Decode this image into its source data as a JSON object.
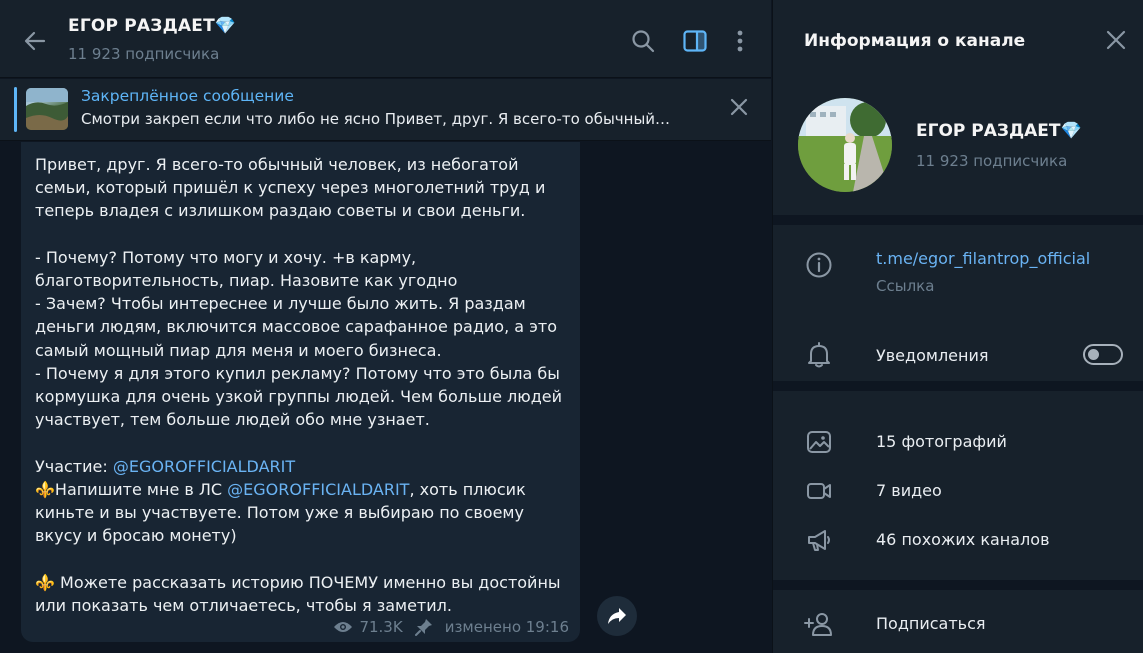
{
  "header": {
    "title": "ЕГОР РАЗДАЕТ💎",
    "subscribers": "11 923 подписчика"
  },
  "pinned": {
    "title": "Закреплённое сообщение",
    "text": "Смотри закреп если что либо не ясно  Привет, друг. Я всего-то обычный…"
  },
  "message": {
    "p1": "Привет, друг. Я всего-то обычный человек, из небогатой семьи, который пришёл к успеху через многолетний труд и теперь владея с излишком раздаю советы и свои деньги.",
    "p2": "- Почему? Потому что могу и хочу. +в карму, благотворительность, пиар. Назовите как угодно\n- Зачем? Чтобы интереснее и лучше было жить. Я раздам деньги людям, включится массовое сарафанное радио, а это самый мощный пиар для меня и моего бизнеса.\n- Почему я для этого купил рекламу? Потому что это была бы кормушка для очень узкой группы людей. Чем больше людей участвует, тем больше людей обо мне узнает.",
    "participation_label": "Участие: ",
    "mention": "@EGOROFFICIALDARIT",
    "write_prefix": "⚜️Напишите мне в ЛС ",
    "write_suffix": ", хоть плюсик киньте и вы участвуете. Потом уже я выбираю по своему вкусу и бросаю монету)",
    "p4": "⚜️ Можете рассказать историю ПОЧЕМУ именно вы достойны или показать чем отличаетесь, чтобы я заметил.",
    "views": "71.3K",
    "edited": "изменено 19:16"
  },
  "info_panel": {
    "title": "Информация о канале",
    "channel_name": "ЕГОР РАЗДАЕТ💎",
    "subscribers": "11 923 подписчика",
    "link": "t.me/egor_filantrop_official",
    "link_label": "Ссылка",
    "notifications": "Уведомления",
    "notifications_enabled": false,
    "photos": "15 фотографий",
    "videos": "7 видео",
    "similar": "46 похожих каналов",
    "subscribe": "Подписаться"
  },
  "colors": {
    "accent": "#6ab3f3",
    "panel": "#17212b",
    "background": "#0e1621",
    "bubble": "#182533"
  },
  "icons": [
    "back-arrow-icon",
    "search-icon",
    "sidebar-toggle-icon",
    "more-vertical-icon",
    "close-icon",
    "info-icon",
    "bell-icon",
    "photo-icon",
    "video-icon",
    "megaphone-icon",
    "add-user-icon",
    "eye-icon",
    "pin-icon",
    "share-arrow-icon"
  ]
}
